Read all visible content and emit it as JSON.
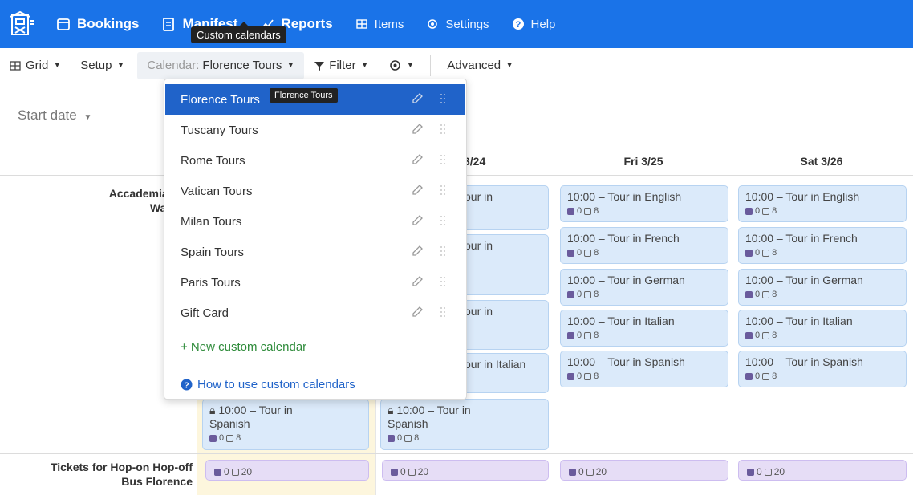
{
  "nav": {
    "bookings": "Bookings",
    "manifest": "Manifest",
    "reports": "Reports",
    "items": "Items",
    "settings": "Settings",
    "help": "Help",
    "tooltip": "Custom calendars"
  },
  "toolbar": {
    "grid": "Grid",
    "setup": "Setup",
    "calendar_prefix": "Calendar:",
    "calendar_value": "Florence Tours",
    "filter": "Filter",
    "advanced": "Advanced"
  },
  "start_date": "Start date",
  "columns": {
    "partial": "3/24",
    "fri": "Fri 3/25",
    "sat": "Sat 3/26"
  },
  "rows": {
    "row1_line1": "Accademia Gall",
    "row1_line2": "Walking",
    "row2_line1": "Tickets for Hop-on Hop-off",
    "row2_line2": "Bus Florence"
  },
  "slots": {
    "english": "10:00 – Tour in English",
    "french": "10:00 – Tour in French",
    "german": "10:00 – Tour in German",
    "italian": "10:00 – Tour in Italian",
    "spanish": "10:00 – Tour in Spanish",
    "locked_line1": "10:00 – Tour in",
    "locked_line2": "Spanish",
    "partial_in": "our in",
    "partial_italian": "our in Italian",
    "cap_zero": "0",
    "cap_eight": "8",
    "cap_twenty": "20"
  },
  "dropdown": {
    "items": [
      "Florence Tours",
      "Tuscany Tours",
      "Rome Tours",
      "Vatican Tours",
      "Milan Tours",
      "Spain Tours",
      "Paris Tours",
      "Gift Card"
    ],
    "item_tooltip": "Florence Tours",
    "new_calendar": "+ New custom calendar",
    "help_link": "How to use custom calendars"
  },
  "colors": {
    "primary": "#1a73e8",
    "selected": "#2063c9",
    "slot_blue": "#dbeafa",
    "slot_purple": "#e6ddf6",
    "highlight": "#fdf6dd",
    "new_link": "#2e8b3a"
  }
}
